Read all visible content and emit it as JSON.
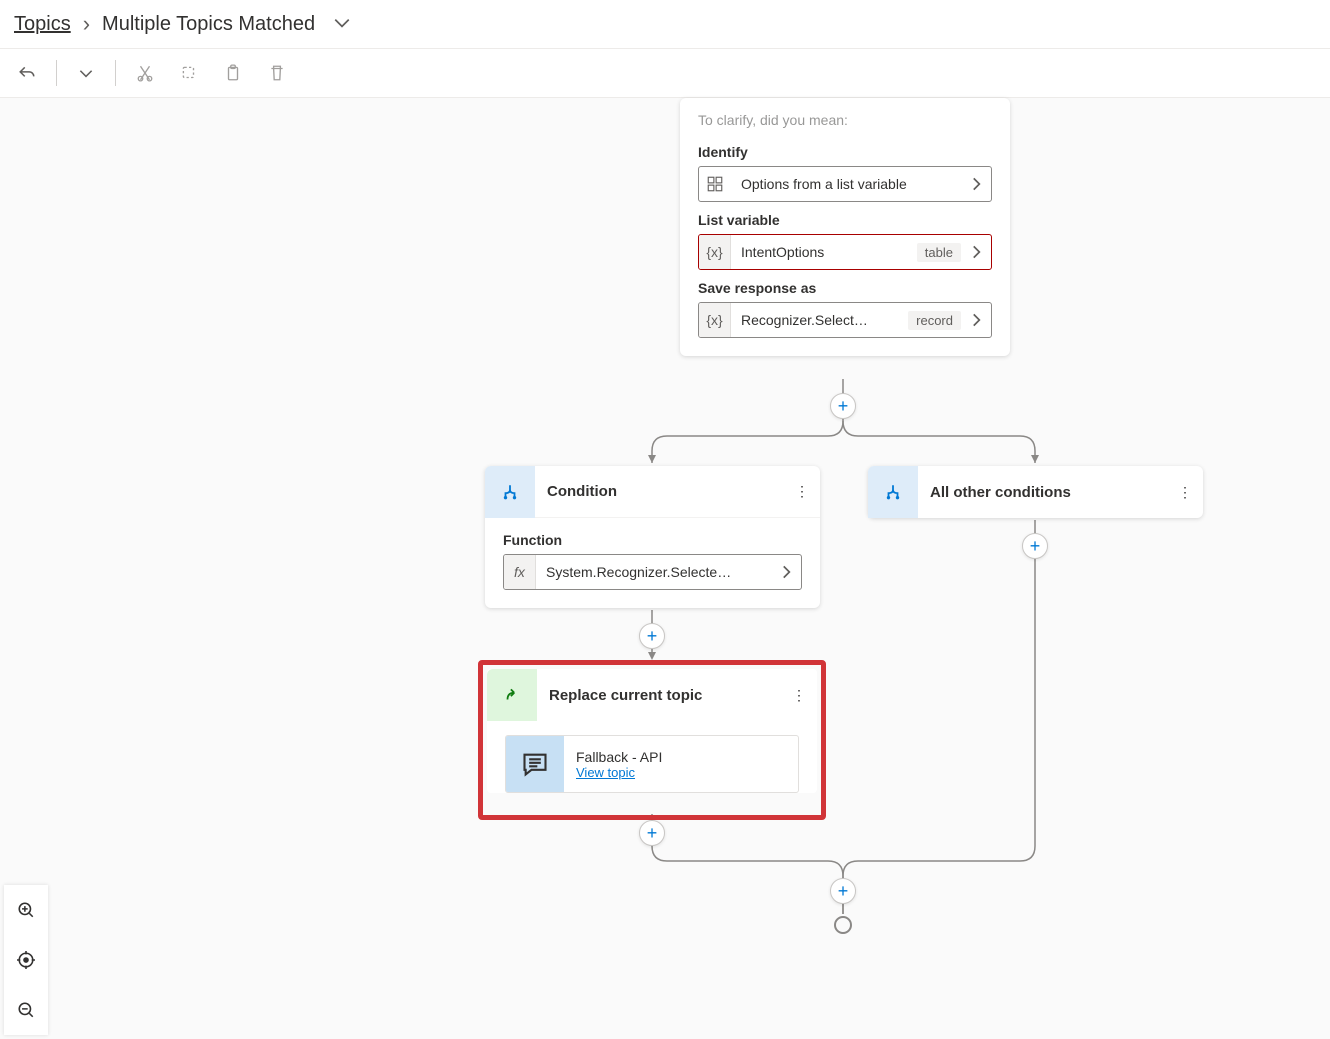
{
  "breadcrumb": {
    "root": "Topics",
    "current": "Multiple Topics Matched"
  },
  "question_card": {
    "prompt": "To clarify, did you mean:",
    "identify_label": "Identify",
    "identify_value": "Options from a list variable",
    "listvar_label": "List variable",
    "listvar_value": "IntentOptions",
    "listvar_type": "table",
    "save_label": "Save response as",
    "save_value": "Recognizer.Select…",
    "save_type": "record"
  },
  "condition_card": {
    "title": "Condition",
    "function_label": "Function",
    "function_value": "System.Recognizer.Selecte…"
  },
  "other_card": {
    "title": "All other conditions"
  },
  "replace_card": {
    "title": "Replace current topic",
    "topic_name": "Fallback - API",
    "view_link": "View topic"
  }
}
